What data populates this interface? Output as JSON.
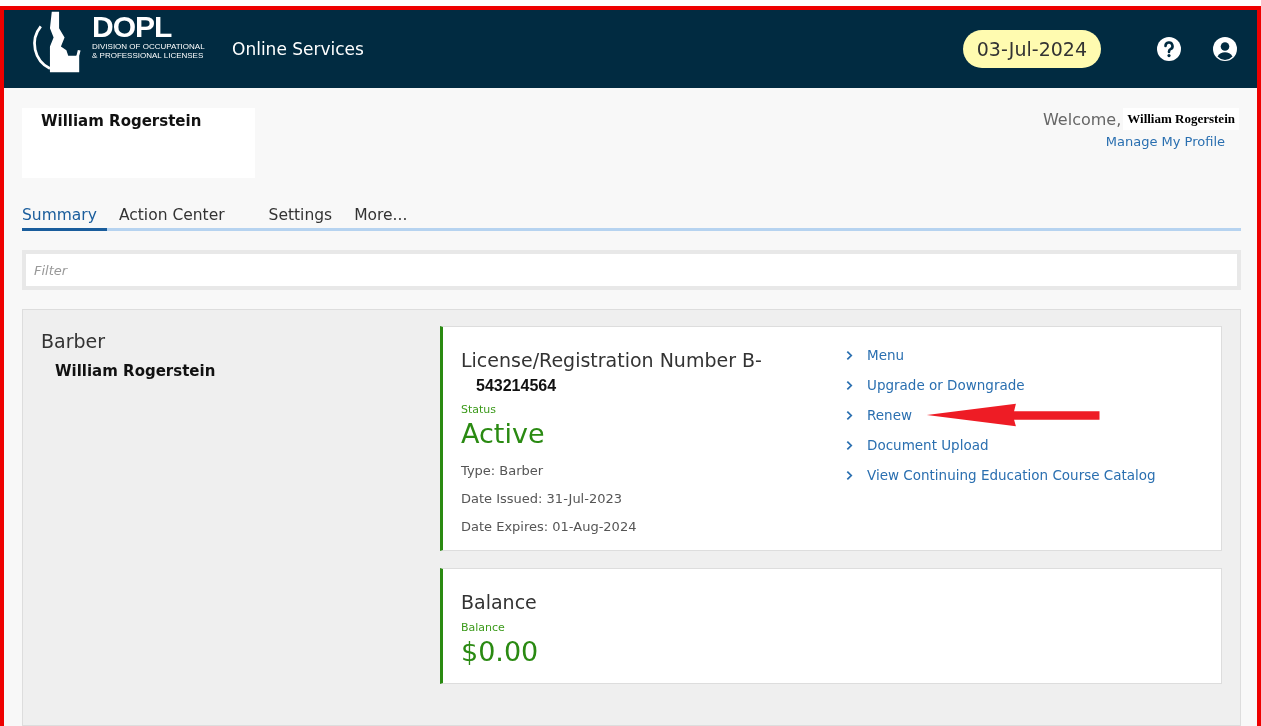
{
  "header": {
    "logo": {
      "title": "DOPL",
      "subtitle": "DIVISION OF OCCUPATIONAL & PROFESSIONAL LICENSES"
    },
    "app_title": "Online Services",
    "date": "03-Jul-2024"
  },
  "user": {
    "name": "William Rogerstein",
    "welcome": "Welcome,",
    "welcome_name": "William Rogerstein",
    "profile_link": "Manage My Profile"
  },
  "tabs": [
    {
      "label": "Summary",
      "selected": true
    },
    {
      "label": "Action Center",
      "selected": false
    },
    {
      "label": "Settings",
      "selected": false
    },
    {
      "label": "More...",
      "selected": false
    }
  ],
  "filter": {
    "placeholder": "Filter"
  },
  "license_holder": {
    "profession": "Barber",
    "name": "William Rogerstein"
  },
  "license_card": {
    "title": "License/Registration Number B-",
    "number": "543214564",
    "status_label": "Status",
    "status": "Active",
    "details": [
      "Type: Barber",
      "Date Issued: 31-Jul-2023",
      "Date Expires: 01-Aug-2024"
    ],
    "actions": [
      {
        "label": "Menu",
        "marked": false
      },
      {
        "label": "Upgrade or Downgrade",
        "marked": false
      },
      {
        "label": "Renew",
        "marked": true
      },
      {
        "label": "Document Upload",
        "marked": false
      },
      {
        "label": "View Continuing Education Course Catalog",
        "marked": false
      }
    ]
  },
  "balance_card": {
    "title": "Balance",
    "label": "Balance",
    "amount": "$0.00"
  }
}
